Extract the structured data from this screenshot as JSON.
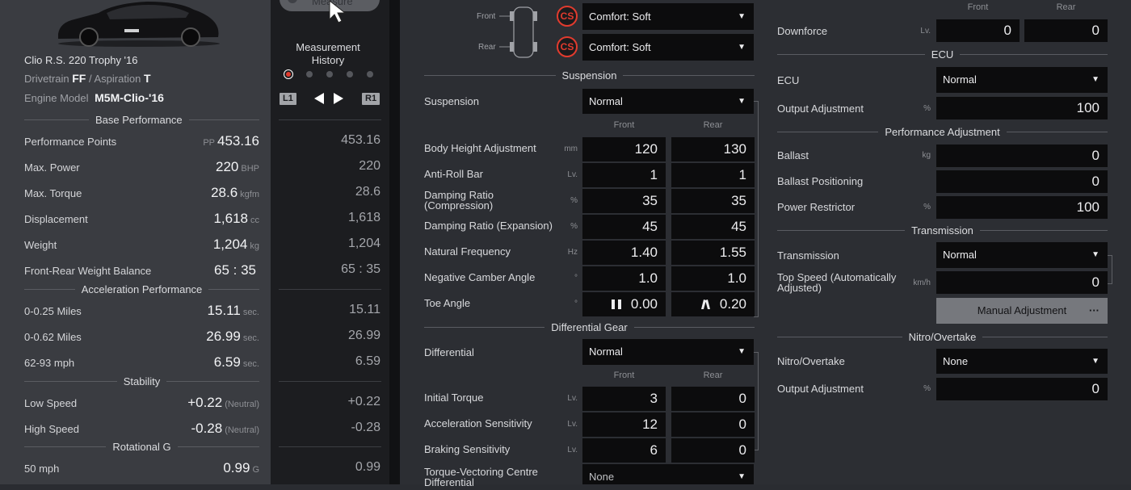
{
  "car": {
    "name": "Clio R.S. 220 Trophy '16",
    "drivetrain_label": "Drivetrain",
    "drivetrain": "FF",
    "separator": "/",
    "aspiration_label": "Aspiration",
    "aspiration": "T",
    "engine_label": "Engine Model",
    "engine": "M5M-Clio-'16"
  },
  "base_performance": {
    "title": "Base Performance",
    "pp_prefix": "PP",
    "rows": [
      {
        "label": "Performance Points",
        "value": "453.16",
        "unit": "",
        "history": "453.16"
      },
      {
        "label": "Max. Power",
        "value": "220",
        "unit": "BHP",
        "history": "220"
      },
      {
        "label": "Max. Torque",
        "value": "28.6",
        "unit": "kgfm",
        "history": "28.6"
      },
      {
        "label": "Displacement",
        "value": "1,618",
        "unit": "cc",
        "history": "1,618"
      },
      {
        "label": "Weight",
        "value": "1,204",
        "unit": "kg",
        "history": "1,204"
      },
      {
        "label": "Front-Rear Weight Balance",
        "value": "65 : 35",
        "unit": "",
        "history": "65 : 35"
      }
    ]
  },
  "acceleration": {
    "title": "Acceleration Performance",
    "rows": [
      {
        "label": "0-0.25 Miles",
        "value": "15.11",
        "unit": "sec.",
        "history": "15.11"
      },
      {
        "label": "0-0.62 Miles",
        "value": "26.99",
        "unit": "sec.",
        "history": "26.99"
      },
      {
        "label": "62-93 mph",
        "value": "6.59",
        "unit": "sec.",
        "history": "6.59"
      }
    ]
  },
  "stability": {
    "title": "Stability",
    "rows": [
      {
        "label": "Low Speed",
        "value": "+0.22",
        "unit": "(Neutral)",
        "history": "+0.22"
      },
      {
        "label": "High Speed",
        "value": "-0.28",
        "unit": "(Neutral)",
        "history": "-0.28"
      }
    ]
  },
  "rotational": {
    "title": "Rotational G",
    "rows": [
      {
        "label": "50 mph",
        "value": "0.99",
        "unit": "G",
        "history": "0.99"
      }
    ]
  },
  "history": {
    "measure_button": "Measure",
    "title_line1": "Measurement",
    "title_line2": "History",
    "key_left": "L1",
    "key_right": "R1"
  },
  "tyres": {
    "front_label": "Front",
    "rear_label": "Rear",
    "badge": "CS",
    "front_value": "Comfort: Soft",
    "rear_value": "Comfort: Soft"
  },
  "suspension": {
    "title": "Suspension",
    "label": "Suspension",
    "value": "Normal",
    "col_front": "Front",
    "col_rear": "Rear",
    "rows": [
      {
        "label": "Body Height Adjustment",
        "unit": "mm",
        "front": "120",
        "rear": "130"
      },
      {
        "label": "Anti-Roll Bar",
        "unit": "Lv.",
        "front": "1",
        "rear": "1"
      },
      {
        "label": "Damping Ratio (Compression)",
        "unit": "%",
        "front": "35",
        "rear": "35"
      },
      {
        "label": "Damping Ratio (Expansion)",
        "unit": "%",
        "front": "45",
        "rear": "45"
      },
      {
        "label": "Natural Frequency",
        "unit": "Hz",
        "front": "1.40",
        "rear": "1.55"
      },
      {
        "label": "Negative Camber Angle",
        "unit": "°",
        "front": "1.0",
        "rear": "1.0"
      },
      {
        "label": "Toe Angle",
        "unit": "°",
        "front": "0.00",
        "rear": "0.20"
      }
    ]
  },
  "differential": {
    "title": "Differential Gear",
    "label": "Differential",
    "value": "Normal",
    "col_front": "Front",
    "col_rear": "Rear",
    "rows": [
      {
        "label": "Initial Torque",
        "unit": "Lv.",
        "front": "3",
        "rear": "0"
      },
      {
        "label": "Acceleration Sensitivity",
        "unit": "Lv.",
        "front": "12",
        "rear": "0"
      },
      {
        "label": "Braking Sensitivity",
        "unit": "Lv.",
        "front": "6",
        "rear": "0"
      }
    ],
    "torque_vectoring_label": "Torque-Vectoring Centre Differential",
    "torque_vectoring_value": "None"
  },
  "aero": {
    "col_front": "Front",
    "col_rear": "Rear",
    "downforce_label": "Downforce",
    "downforce_unit": "Lv.",
    "downforce_front": "0",
    "downforce_rear": "0"
  },
  "ecu": {
    "title": "ECU",
    "label": "ECU",
    "value": "Normal",
    "output_label": "Output Adjustment",
    "output_unit": "%",
    "output_value": "100"
  },
  "performance_adjustment": {
    "title": "Performance Adjustment",
    "ballast_label": "Ballast",
    "ballast_unit": "kg",
    "ballast_value": "0",
    "positioning_label": "Ballast Positioning",
    "positioning_value": "0",
    "restrictor_label": "Power Restrictor",
    "restrictor_unit": "%",
    "restrictor_value": "100"
  },
  "transmission": {
    "title": "Transmission",
    "label": "Transmission",
    "value": "Normal",
    "top_speed_label": "Top Speed (Automatically Adjusted)",
    "top_speed_unit": "km/h",
    "top_speed_value": "0",
    "manual_button": "Manual Adjustment",
    "more_icon": "···"
  },
  "nitro": {
    "title": "Nitro/Overtake",
    "label": "Nitro/Overtake",
    "value": "None",
    "output_label": "Output Adjustment",
    "output_unit": "%",
    "output_value": "0"
  }
}
